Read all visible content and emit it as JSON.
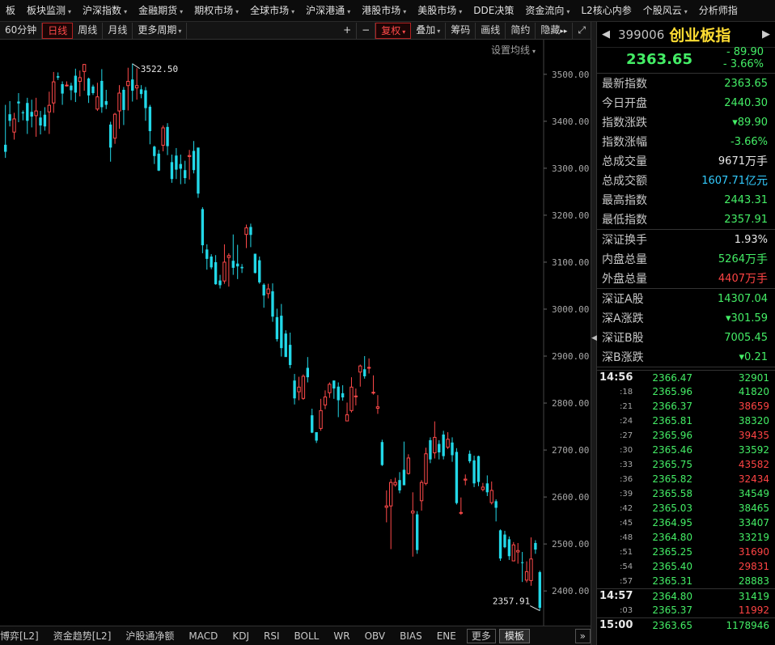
{
  "top_menu": [
    {
      "label": "板",
      "caret": false
    },
    {
      "label": "板块监测",
      "caret": true
    },
    {
      "label": "沪深指数",
      "caret": true
    },
    {
      "label": "金融期货",
      "caret": true
    },
    {
      "label": "期权市场",
      "caret": true
    },
    {
      "label": "全球市场",
      "caret": true
    },
    {
      "label": "沪深港通",
      "caret": true
    },
    {
      "label": "港股市场",
      "caret": true
    },
    {
      "label": "美股市场",
      "caret": true
    },
    {
      "label": "DDE决策",
      "caret": false
    },
    {
      "label": "资金流向",
      "caret": true
    },
    {
      "label": "L2核心内参",
      "caret": false
    },
    {
      "label": "个股风云",
      "caret": true
    },
    {
      "label": "分析师指",
      "caret": false
    }
  ],
  "toolbar": {
    "min60": "60分钟",
    "daily": "日线",
    "weekly": "周线",
    "monthly": "月线",
    "more_period": "更多周期",
    "plus": "+",
    "minus": "−",
    "restore": "复权",
    "overlay": "叠加",
    "chips": "筹码",
    "draw": "画线",
    "simple": "简约",
    "hide": "隐藏",
    "hide_arrows": "▸▸",
    "expand": "⤢"
  },
  "chart": {
    "ma_setting": "设置均线",
    "high_label": "3522.50",
    "low_label": "2357.91"
  },
  "chart_data": {
    "type": "candlestick",
    "ylim": [
      2340,
      3560
    ],
    "y_ticks": [
      3500,
      3400,
      3300,
      3200,
      3100,
      3000,
      2900,
      2800,
      2700,
      2600,
      2500,
      2400
    ],
    "y_tick_labels": [
      "3500.00",
      "3400.00",
      "3300.00",
      "3200.00",
      "3100.00",
      "3000.00",
      "2900.00",
      "2800.00",
      "2700.00",
      "2600.00",
      "2500.00",
      "2400.00"
    ],
    "max_marker": 3522.5,
    "min_marker": 2357.91,
    "colors": {
      "up": "#ff4a4a",
      "down": "#22d8e8"
    },
    "candles": [
      [
        3350,
        3335,
        3435,
        3322
      ],
      [
        3415,
        3401,
        3443,
        3389
      ],
      [
        3377,
        3405,
        3418,
        3361
      ],
      [
        3442,
        3438,
        3460,
        3398
      ],
      [
        3419,
        3417,
        3423,
        3402
      ],
      [
        3439,
        3401,
        3450,
        3373
      ],
      [
        3420,
        3410,
        3446,
        3387
      ],
      [
        3412,
        3422,
        3450,
        3367
      ],
      [
        3408,
        3391,
        3422,
        3372
      ],
      [
        3414,
        3389,
        3430,
        3380
      ],
      [
        3420,
        3434,
        3463,
        3373
      ],
      [
        3439,
        3484,
        3505,
        3418
      ],
      [
        3496,
        3493,
        3504,
        3488
      ],
      [
        3479,
        3459,
        3485,
        3435
      ],
      [
        3477,
        3477,
        3485,
        3474
      ],
      [
        3476,
        3466,
        3482,
        3445
      ],
      [
        3497,
        3461,
        3512,
        3441
      ],
      [
        3485,
        3493,
        3508,
        3453
      ],
      [
        3506,
        3521,
        3522,
        3465
      ],
      [
        3491,
        3455,
        3493,
        3439
      ],
      [
        3474,
        3460,
        3478,
        3456
      ],
      [
        3426,
        3452,
        3482,
        3422
      ],
      [
        3486,
        3430,
        3511,
        3418
      ],
      [
        3443,
        3435,
        3467,
        3426
      ],
      [
        3393,
        3344,
        3399,
        3314
      ],
      [
        3364,
        3415,
        3418,
        3352
      ],
      [
        3422,
        3460,
        3477,
        3384
      ],
      [
        3467,
        3424,
        3473,
        3392
      ],
      [
        3476,
        3485,
        3514,
        3423
      ],
      [
        3489,
        3465,
        3523,
        3442
      ],
      [
        3471,
        3476,
        3513,
        3446
      ],
      [
        3468,
        3458,
        3477,
        3449
      ],
      [
        3466,
        3428,
        3473,
        3401
      ],
      [
        3431,
        3379,
        3435,
        3351
      ],
      [
        3346,
        3326,
        3348,
        3309
      ],
      [
        3331,
        3295,
        3339,
        3294
      ],
      [
        3349,
        3386,
        3391,
        3336
      ],
      [
        3388,
        3347,
        3396,
        3328
      ],
      [
        3313,
        3277,
        3329,
        3269
      ],
      [
        3327,
        3297,
        3343,
        3277
      ],
      [
        3309,
        3299,
        3329,
        3266
      ],
      [
        3296,
        3279,
        3316,
        3267
      ],
      [
        3325,
        3327,
        3339,
        3276
      ],
      [
        3337,
        3296,
        3358,
        3289
      ],
      [
        3344,
        3246,
        3344,
        3237
      ],
      [
        3213,
        3136,
        3217,
        3119
      ],
      [
        3127,
        3107,
        3138,
        3084
      ],
      [
        3112,
        3089,
        3117,
        3085
      ],
      [
        3100,
        3053,
        3115,
        3052
      ],
      [
        3061,
        3051,
        3073,
        3044
      ],
      [
        3060,
        3100,
        3138,
        3054
      ],
      [
        3110,
        3114,
        3119,
        3048
      ],
      [
        3103,
        3088,
        3159,
        3073
      ],
      [
        3097,
        3091,
        3137,
        3064
      ],
      [
        3090,
        3087,
        3096,
        3077
      ],
      [
        3159,
        3173,
        3180,
        3130
      ],
      [
        3175,
        3158,
        3182,
        3132
      ],
      [
        3118,
        3077,
        3118,
        3076
      ],
      [
        3104,
        3057,
        3112,
        3054
      ],
      [
        3052,
        3029,
        3055,
        3003
      ],
      [
        3033,
        3043,
        3054,
        3023
      ],
      [
        3038,
        2984,
        3055,
        2973
      ],
      [
        2983,
        2936,
        3001,
        2931
      ],
      [
        2986,
        2917,
        3011,
        2899
      ],
      [
        2948,
        2898,
        2955,
        2904
      ],
      [
        2924,
        2881,
        2950,
        2874
      ],
      [
        2848,
        2810,
        2862,
        2797
      ],
      [
        2824,
        2834,
        2856,
        2806
      ],
      [
        2810,
        2857,
        2861,
        2807
      ],
      [
        2875,
        2855,
        2898,
        2844
      ],
      [
        2774,
        2737,
        2788,
        2736
      ],
      [
        2738,
        2720,
        2738,
        2715
      ],
      [
        2746,
        2784,
        2809,
        2741
      ],
      [
        2796,
        2813,
        2827,
        2787
      ],
      [
        2822,
        2840,
        2844,
        2811
      ],
      [
        2848,
        2831,
        2848,
        2809
      ],
      [
        2835,
        2806,
        2844,
        2770
      ],
      [
        2821,
        2812,
        2838,
        2805
      ],
      [
        2762,
        2775,
        2801,
        2768
      ],
      [
        2784,
        2834,
        2855,
        2780
      ],
      [
        2814,
        2815,
        2831,
        2795
      ],
      [
        2866,
        2879,
        2882,
        2835
      ],
      [
        2872,
        2857,
        2900,
        2852
      ],
      [
        2875,
        2876,
        2895,
        2863
      ],
      [
        2823,
        2823,
        2859,
        2818
      ],
      [
        2789,
        2792,
        2817,
        2777
      ],
      [
        2717,
        2668,
        2722,
        2666
      ],
      [
        2578,
        2581,
        2614,
        2546
      ],
      [
        2581,
        2631,
        2638,
        2489
      ],
      [
        2626,
        2631,
        2641,
        2622
      ],
      [
        2636,
        2614,
        2653,
        2608
      ],
      [
        2658,
        2625,
        2718,
        2627
      ],
      [
        2650,
        2683,
        2691,
        2648
      ],
      [
        2566,
        2570,
        2610,
        2473
      ],
      [
        2563,
        2487,
        2570,
        2479
      ],
      [
        2592,
        2631,
        2636,
        2571
      ],
      [
        2629,
        2692,
        2705,
        2625
      ],
      [
        2721,
        2680,
        2727,
        2672
      ],
      [
        2694,
        2727,
        2761,
        2682
      ],
      [
        2713,
        2695,
        2721,
        2680
      ],
      [
        2733,
        2687,
        2741,
        2680
      ],
      [
        2706,
        2723,
        2738,
        2702
      ],
      [
        2716,
        2689,
        2727,
        2675
      ],
      [
        2696,
        2587,
        2704,
        2584
      ],
      [
        2566,
        2567,
        2599,
        2562
      ],
      [
        2636,
        2638,
        2648,
        2625
      ],
      [
        2692,
        2676,
        2699,
        2672
      ],
      [
        2678,
        2629,
        2688,
        2621
      ],
      [
        2687,
        2632,
        2688,
        2623
      ],
      [
        2616,
        2621,
        2630,
        2612
      ],
      [
        2629,
        2610,
        2646,
        2602
      ],
      [
        2588,
        2614,
        2633,
        2584
      ],
      [
        2591,
        2577,
        2595,
        2548
      ],
      [
        2529,
        2469,
        2531,
        2464
      ],
      [
        2520,
        2493,
        2528,
        2491
      ],
      [
        2510,
        2474,
        2516,
        2466
      ],
      [
        2464,
        2498,
        2504,
        2463
      ],
      [
        2483,
        2486,
        2502,
        2458
      ],
      [
        2461,
        2460,
        2483,
        2419
      ],
      [
        2423,
        2441,
        2463,
        2418
      ],
      [
        2422,
        2468,
        2514,
        2411
      ],
      [
        2502,
        2488,
        2508,
        2479
      ],
      [
        2440,
        2364,
        2443,
        2358
      ]
    ]
  },
  "bottom_tabs": [
    {
      "label": "博弈[L2]",
      "style": "plain"
    },
    {
      "label": "资金趋势[L2]",
      "style": "plain"
    },
    {
      "label": "沪股通净额",
      "style": "plain"
    },
    {
      "label": "MACD",
      "style": "plain"
    },
    {
      "label": "KDJ",
      "style": "plain"
    },
    {
      "label": "RSI",
      "style": "plain"
    },
    {
      "label": "BOLL",
      "style": "plain"
    },
    {
      "label": "WR",
      "style": "plain"
    },
    {
      "label": "OBV",
      "style": "plain"
    },
    {
      "label": "BIAS",
      "style": "plain"
    },
    {
      "label": "ENE",
      "style": "plain"
    },
    {
      "label": "更多",
      "style": "boxed"
    },
    {
      "label": "模板",
      "style": "tpl"
    }
  ],
  "bottom_right_arrow": "»",
  "splitter_arrow": "◀",
  "quote": {
    "nav_prev": "◀",
    "nav_next": "▶",
    "code": "399006",
    "name": "创业板指",
    "price": "2363.65",
    "change": "- 89.90",
    "pct": "- 3.66%",
    "sections": [
      [
        {
          "label": "最新指数",
          "value": "2363.65",
          "color": "g",
          "unit": ""
        },
        {
          "label": "今日开盘",
          "value": "2440.30",
          "color": "g",
          "unit": ""
        },
        {
          "label": "指数涨跌",
          "value": "▾89.90",
          "color": "g",
          "unit": ""
        },
        {
          "label": "指数涨幅",
          "value": "-3.66%",
          "color": "g",
          "unit": ""
        },
        {
          "label": "总成交量",
          "value": "9671",
          "color": "w",
          "unit": "万手"
        },
        {
          "label": "总成交额",
          "value": "1607.71",
          "color": "c",
          "unit": "亿元"
        },
        {
          "label": "最高指数",
          "value": "2443.31",
          "color": "g",
          "unit": ""
        },
        {
          "label": "最低指数",
          "value": "2357.91",
          "color": "g",
          "unit": ""
        }
      ],
      [
        {
          "label": "深证换手",
          "value": "1.93%",
          "color": "w",
          "unit": ""
        },
        {
          "label": "内盘总量",
          "value": "5264",
          "color": "g",
          "unit": "万手"
        },
        {
          "label": "外盘总量",
          "value": "4407",
          "color": "r",
          "unit": "万手"
        }
      ],
      [
        {
          "label": "深证A股",
          "value": "14307.04",
          "color": "g",
          "unit": ""
        },
        {
          "label": "深A涨跌",
          "value": "▾301.59",
          "color": "g",
          "unit": ""
        },
        {
          "label": "深证B股",
          "value": "7005.45",
          "color": "g",
          "unit": ""
        },
        {
          "label": "深B涨跌",
          "value": "▾0.21",
          "color": "g",
          "unit": ""
        }
      ]
    ],
    "ticks": [
      {
        "time": "14:56",
        "major": true,
        "price": "2366.47",
        "vol": "32901",
        "color": "g"
      },
      {
        "time": ":18",
        "major": false,
        "price": "2365.96",
        "vol": "41820",
        "color": "g"
      },
      {
        "time": ":21",
        "major": false,
        "price": "2366.37",
        "vol": "38659",
        "color": "r"
      },
      {
        "time": ":24",
        "major": false,
        "price": "2365.81",
        "vol": "38320",
        "color": "g"
      },
      {
        "time": ":27",
        "major": false,
        "price": "2365.96",
        "vol": "39435",
        "color": "r"
      },
      {
        "time": ":30",
        "major": false,
        "price": "2365.46",
        "vol": "33592",
        "color": "g"
      },
      {
        "time": ":33",
        "major": false,
        "price": "2365.75",
        "vol": "43582",
        "color": "r"
      },
      {
        "time": ":36",
        "major": false,
        "price": "2365.82",
        "vol": "32434",
        "color": "r"
      },
      {
        "time": ":39",
        "major": false,
        "price": "2365.58",
        "vol": "34549",
        "color": "g"
      },
      {
        "time": ":42",
        "major": false,
        "price": "2365.03",
        "vol": "38465",
        "color": "g"
      },
      {
        "time": ":45",
        "major": false,
        "price": "2364.95",
        "vol": "33407",
        "color": "g"
      },
      {
        "time": ":48",
        "major": false,
        "price": "2364.80",
        "vol": "33219",
        "color": "g"
      },
      {
        "time": ":51",
        "major": false,
        "price": "2365.25",
        "vol": "31690",
        "color": "r"
      },
      {
        "time": ":54",
        "major": false,
        "price": "2365.40",
        "vol": "29831",
        "color": "r"
      },
      {
        "time": ":57",
        "major": false,
        "price": "2365.31",
        "vol": "28883",
        "color": "g"
      },
      {
        "time": "14:57",
        "major": true,
        "price": "2364.80",
        "vol": "31419",
        "color": "g"
      },
      {
        "time": ":03",
        "major": false,
        "price": "2365.37",
        "vol": "11992",
        "color": "r"
      },
      {
        "time": "15:00",
        "major": true,
        "price": "2363.65",
        "vol": "1178946",
        "color": "g"
      }
    ]
  }
}
